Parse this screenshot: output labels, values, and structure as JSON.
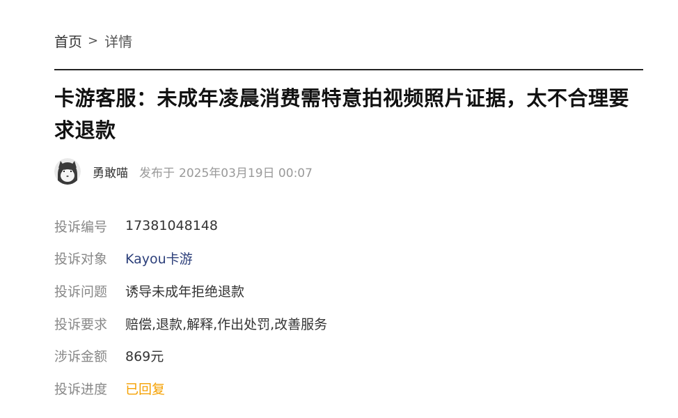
{
  "breadcrumb": {
    "home": "首页",
    "separator": ">",
    "current": "详情"
  },
  "article": {
    "title": "卡游客服：未成年凌晨消费需特意拍视频照片证据，太不合理要求退款",
    "author": "勇敢喵",
    "publish_prefix": "发布于",
    "publish_time": "2025年03月19日 00:07"
  },
  "complaint": {
    "fields": [
      {
        "label": "投诉编号",
        "value": "17381048148",
        "style": "normal"
      },
      {
        "label": "投诉对象",
        "value": "Kayou卡游",
        "style": "link"
      },
      {
        "label": "投诉问题",
        "value": "诱导未成年拒绝退款",
        "style": "normal"
      },
      {
        "label": "投诉要求",
        "value": "赔偿,退款,解释,作出处罚,改善服务",
        "style": "normal"
      },
      {
        "label": "涉诉金额",
        "value": "869元",
        "style": "normal"
      },
      {
        "label": "投诉进度",
        "value": "已回复",
        "style": "status"
      }
    ]
  },
  "icons": {
    "avatar": "cat-avatar-icon"
  },
  "colors": {
    "link": "#2c3f7a",
    "status": "#f5a000",
    "label": "#888888",
    "text": "#333333"
  }
}
